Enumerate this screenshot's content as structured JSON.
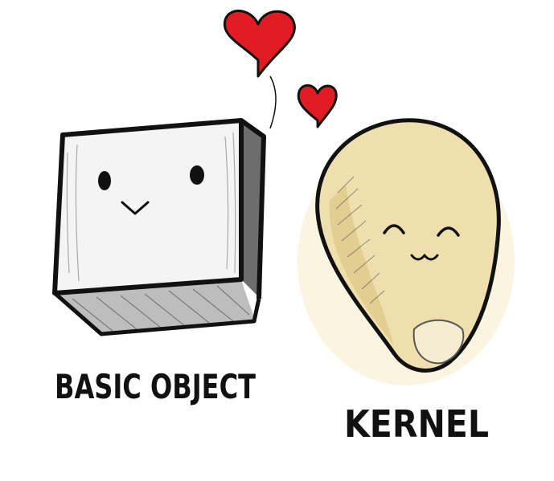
{
  "labels": {
    "basic_object": "BASIC OBJECT",
    "kernel": "KERNEL"
  },
  "characters": [
    {
      "name": "Basic Object",
      "shape": "cube",
      "expression": "smiling"
    },
    {
      "name": "Kernel",
      "shape": "kernel-blob",
      "expression": "smiling"
    }
  ],
  "decorations": {
    "hearts": 2,
    "heart_icon": "heart-icon"
  },
  "colors": {
    "heart": "#e01b22",
    "kernel_fill": "#f0dfae",
    "kernel_shade": "#d9c07a",
    "ink": "#111111",
    "cube_face": "#f4f4f4",
    "cube_shadow": "#9a9a9a"
  }
}
